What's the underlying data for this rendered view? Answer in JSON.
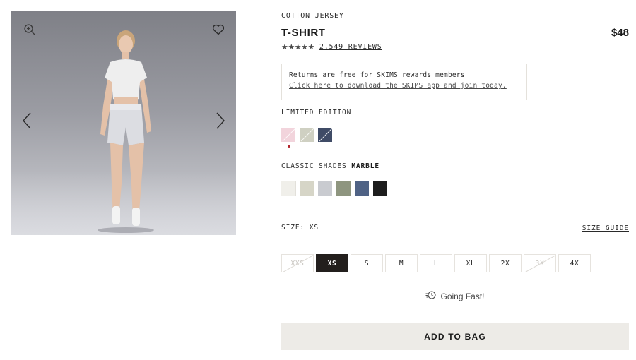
{
  "media": {
    "image_alt": "Model wearing white cotton jersey t-shirt and grey shorts",
    "icons": [
      "zoom-in-icon",
      "heart-icon",
      "chevron-left-icon",
      "chevron-right-icon"
    ]
  },
  "product": {
    "eyebrow": "COTTON JERSEY",
    "title": "T-SHIRT",
    "price": "$48",
    "rating": 5,
    "reviews": "2,549 REVIEWS"
  },
  "promo": {
    "line1": "Returns are free for SKIMS rewards members",
    "line2": "Click here to download the SKIMS app and join today."
  },
  "limited": {
    "label": "LIMITED EDITION",
    "swatches": [
      {
        "color": "#f2d4dc",
        "sold_out": true,
        "selected": true
      },
      {
        "color": "#cfd0c2",
        "sold_out": true,
        "selected": false
      },
      {
        "color": "#3f4b66",
        "sold_out": true,
        "selected": false
      }
    ],
    "selected_dot_color": "#b3262d"
  },
  "classic": {
    "label": "CLASSIC SHADES",
    "selected_name": "MARBLE",
    "swatches": [
      {
        "color": "#f0efea"
      },
      {
        "color": "#d6d5c7"
      },
      {
        "color": "#c9cbd0"
      },
      {
        "color": "#8e957f"
      },
      {
        "color": "#4f6285"
      },
      {
        "color": "#1d1d1d"
      }
    ]
  },
  "size": {
    "label": "SIZE: XS",
    "guide_label": "SIZE GUIDE",
    "options": [
      {
        "label": "XXS",
        "state": "unavailable"
      },
      {
        "label": "XS",
        "state": "selected"
      },
      {
        "label": "S",
        "state": "available"
      },
      {
        "label": "M",
        "state": "available"
      },
      {
        "label": "L",
        "state": "available"
      },
      {
        "label": "XL",
        "state": "available"
      },
      {
        "label": "2X",
        "state": "available"
      },
      {
        "label": "3X",
        "state": "unavailable"
      },
      {
        "label": "4X",
        "state": "available"
      }
    ]
  },
  "status": {
    "going_fast": "Going Fast!"
  },
  "cta": {
    "add_to_bag": "ADD TO BAG"
  },
  "colors": {
    "accent_dark": "#231f1d",
    "button_bg": "#edebe7",
    "border": "#e6e3de"
  }
}
